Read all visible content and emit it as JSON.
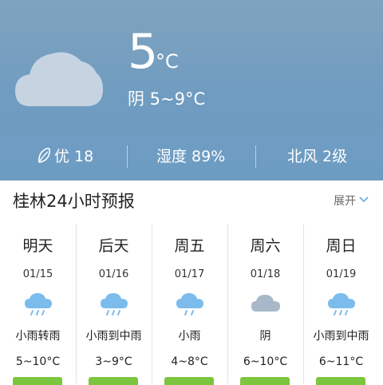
{
  "current": {
    "temperature": "5",
    "unit": "°C",
    "condition": "阴 5~9°C",
    "icon": "cloud-moon-icon",
    "stats": {
      "aqi": "优 18",
      "humidity": "湿度 89%",
      "wind": "北风 2级"
    }
  },
  "forecast_section": {
    "title": "桂林24小时预报",
    "expand_label": "展开"
  },
  "forecast": [
    {
      "day": "明天",
      "date": "01/15",
      "condition": "小雨转雨",
      "temp": "5~10°C",
      "icon": "rain-cloud-icon"
    },
    {
      "day": "后天",
      "date": "01/16",
      "condition": "小雨到中雨",
      "temp": "3~9°C",
      "icon": "rain-cloud-icon"
    },
    {
      "day": "周五",
      "date": "01/17",
      "condition": "小雨",
      "temp": "4~8°C",
      "icon": "rain-cloud-icon"
    },
    {
      "day": "周六",
      "date": "01/18",
      "condition": "阴",
      "temp": "6~10°C",
      "icon": "overcast-cloud-icon"
    },
    {
      "day": "周日",
      "date": "01/19",
      "condition": "小雨到中雨",
      "temp": "6~11°C",
      "icon": "rain-cloud-icon"
    }
  ],
  "colors": {
    "sky": "#6f9cc0",
    "rain_icon": "#7bbcec",
    "overcast_icon": "#a8b8c8",
    "aqi_good": "#7cc53e",
    "moon": "#f2c418"
  }
}
